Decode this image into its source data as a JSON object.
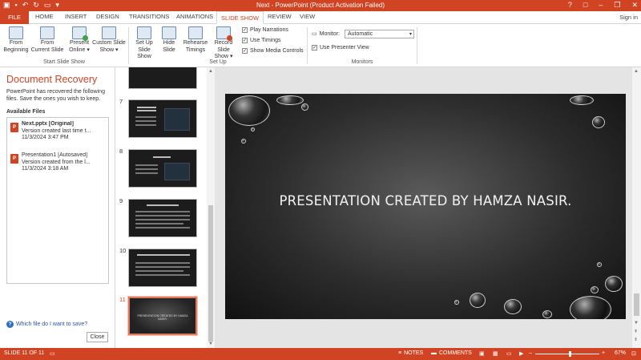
{
  "window": {
    "title": "Next -  PowerPoint (Product Activation Failed)",
    "buttons": [
      "?",
      "□",
      "–",
      "❐",
      "✕"
    ]
  },
  "tabs": {
    "file": "FILE",
    "items": [
      "HOME",
      "INSERT",
      "DESIGN",
      "TRANSITIONS",
      "ANIMATIONS",
      "SLIDE SHOW",
      "REVIEW",
      "VIEW"
    ],
    "active": "SLIDE SHOW",
    "sign_in": "Sign in"
  },
  "ribbon": {
    "start": {
      "from_beginning": [
        "From",
        "Beginning"
      ],
      "from_current": [
        "From",
        "Current Slide"
      ],
      "present_online": [
        "Present",
        "Online ▾"
      ],
      "custom_show": [
        "Custom Slide",
        "Show ▾"
      ],
      "label": "Start Slide Show"
    },
    "setup": {
      "set_up": [
        "Set Up",
        "Slide Show"
      ],
      "hide": [
        "Hide",
        "Slide"
      ],
      "rehearse": [
        "Rehearse",
        "Timings"
      ],
      "record": [
        "Record Slide",
        "Show ▾"
      ],
      "play_narrations": "Play Narrations",
      "use_timings": "Use Timings",
      "show_media": "Show Media Controls",
      "label": "Set Up"
    },
    "monitors": {
      "monitor_label": "Monitor:",
      "monitor_value": "Automatic",
      "presenter_view": "Use Presenter View",
      "label": "Monitors"
    }
  },
  "recovery": {
    "title": "Document Recovery",
    "description": "PowerPoint has recovered the following files.  Save the ones you wish to keep.",
    "available": "Available Files",
    "files": [
      {
        "name": "Next.pptx  [Original]",
        "line2": "Version created last time t...",
        "date": "11/3/2024 3:47 PM"
      },
      {
        "name": "Presentation1  [Autosaved]",
        "line2": "Version created from the l...",
        "date": "11/3/2024 3:18 AM"
      }
    ],
    "help_link": "Which file do I want to save?",
    "close": "Close"
  },
  "thumbnails": {
    "numbers": [
      "7",
      "8",
      "9",
      "10",
      "11"
    ],
    "slide11_text": "PRESENTATION CREATED BY HAMZA NASIR."
  },
  "slide": {
    "headline": "PRESENTATION CREATED BY HAMZA NASIR."
  },
  "status": {
    "slide_info": "SLIDE 11 OF 11",
    "notes": "NOTES",
    "comments": "COMMENTS",
    "zoom": "67%",
    "minus": "–",
    "plus": "+"
  },
  "colors": {
    "accent": "#d04423",
    "slide_background": "#2c2c2c"
  }
}
